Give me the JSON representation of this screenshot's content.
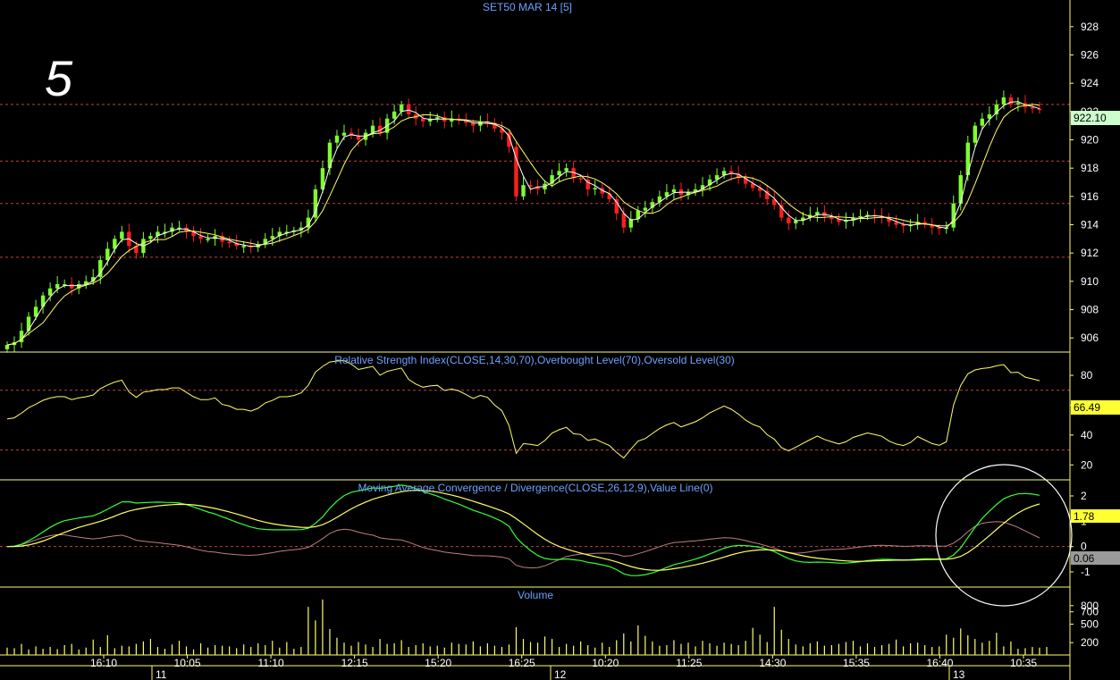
{
  "chart_data": {
    "type": "candlestick",
    "title": "SET50 MAR 14   [5]",
    "corner_label": "5",
    "x_ticks": [
      "16:10",
      "10:05",
      "11:10",
      "12:15",
      "15:20",
      "16:25",
      "10:20",
      "11:25",
      "14:30",
      "15:35",
      "16:40",
      "10:35"
    ],
    "day_labels": [
      "11",
      "12",
      "13"
    ],
    "colors": {
      "up": "#7dff2e",
      "down": "#ff1e1e",
      "grid": "#7a2a2a",
      "border": "#ffff66",
      "fast_ma": "#ffffff",
      "slow_ma": "#ffff66",
      "macd": "#33ff33",
      "signal": "#ffff66",
      "hist": "#c08080",
      "text_blue": "#6ea0ff"
    },
    "price": {
      "ylim": [
        905,
        929
      ],
      "yticks": [
        906,
        908,
        910,
        912,
        914,
        916,
        918,
        920,
        922,
        924,
        926,
        928
      ],
      "ref_lines": [
        922.5,
        918.5,
        915.5,
        911.7
      ],
      "last_value": "922.10",
      "closes": [
        905.5,
        905.7,
        906.5,
        907.5,
        908.2,
        909.0,
        909.5,
        909.8,
        909.8,
        909.5,
        909.8,
        910.0,
        910.3,
        911.5,
        912.3,
        913.0,
        913.5,
        912.5,
        912.0,
        913.0,
        913.2,
        913.5,
        913.5,
        913.8,
        913.8,
        913.5,
        913.2,
        913.0,
        913.0,
        913.2,
        912.8,
        912.7,
        912.5,
        912.5,
        912.4,
        912.6,
        913.0,
        913.2,
        913.5,
        913.5,
        913.6,
        913.8,
        914.5,
        916.5,
        918.0,
        919.8,
        920.3,
        920.5,
        920.3,
        920.0,
        920.5,
        921.0,
        920.5,
        921.5,
        922.0,
        922.5,
        921.8,
        921.5,
        921.3,
        921.5,
        921.6,
        921.3,
        921.5,
        921.4,
        921.2,
        921.0,
        921.3,
        921.2,
        920.8,
        920.5,
        919.5,
        916.0,
        916.8,
        916.7,
        916.5,
        916.9,
        917.5,
        917.8,
        918.0,
        917.3,
        917.2,
        916.5,
        916.6,
        916.2,
        915.8,
        914.8,
        913.8,
        914.4,
        915.0,
        915.2,
        915.6,
        916.0,
        916.3,
        916.5,
        916.1,
        916.3,
        916.5,
        916.8,
        917.2,
        917.5,
        917.8,
        917.6,
        917.3,
        916.9,
        916.6,
        916.4,
        915.8,
        915.4,
        914.5,
        914.1,
        914.3,
        914.5,
        914.7,
        914.9,
        914.6,
        914.4,
        914.2,
        914.3,
        914.5,
        914.6,
        914.7,
        914.6,
        914.5,
        914.2,
        914.0,
        913.9,
        914.0,
        914.2,
        914.0,
        913.8,
        913.7,
        913.8,
        915.5,
        917.5,
        919.8,
        921.0,
        921.5,
        921.8,
        922.5,
        923.0,
        922.5,
        922.6,
        922.3,
        922.2,
        922.1
      ]
    },
    "rsi": {
      "title": "Relative Strength Index(CLOSE,14,30,70),Overbought Level(70),Oversold Level(30)",
      "ylim": [
        10,
        95
      ],
      "yticks": [
        20,
        40,
        60,
        80
      ],
      "ref_lines": [
        70,
        30
      ],
      "last_value": "66.49"
    },
    "macd": {
      "title": "Moving Average Convergence / Divergence(CLOSE,26,12,9),Value Line(0)",
      "ylim": [
        -1.6,
        2.6
      ],
      "yticks": [
        -1,
        0,
        1,
        2
      ],
      "zero_line": 0,
      "macd_value": "1.78",
      "hist_value": "0.06"
    },
    "volume": {
      "title": "Volume",
      "ylim": [
        0,
        1000
      ],
      "yticks": [
        200,
        500,
        700,
        800
      ],
      "values": [
        120,
        110,
        180,
        90,
        140,
        100,
        130,
        95,
        160,
        180,
        90,
        120,
        250,
        130,
        320,
        110,
        150,
        140,
        180,
        220,
        260,
        130,
        100,
        170,
        230,
        140,
        90,
        190,
        120,
        160,
        150,
        140,
        110,
        170,
        130,
        190,
        160,
        230,
        120,
        210,
        100,
        130,
        780,
        560,
        900,
        420,
        280,
        200,
        150,
        210,
        170,
        130,
        260,
        180,
        190,
        240,
        130,
        160,
        190,
        140,
        150,
        120,
        200,
        180,
        170,
        220,
        140,
        190,
        150,
        130,
        170,
        450,
        260,
        210,
        200,
        300,
        260,
        130,
        180,
        150,
        220,
        160,
        120,
        200,
        130,
        240,
        350,
        220,
        480,
        310,
        220,
        150,
        160,
        240,
        180,
        200,
        140,
        230,
        190,
        150,
        200,
        180,
        160,
        230,
        440,
        330,
        210,
        780,
        410,
        260,
        170,
        140,
        190,
        220,
        150,
        160,
        180,
        210,
        230,
        140,
        190,
        130,
        160,
        180,
        250,
        140,
        190,
        200,
        160,
        130,
        140,
        330,
        280,
        430,
        320,
        260,
        200,
        230,
        360,
        140,
        220,
        100,
        110,
        130,
        120,
        130
      ]
    }
  }
}
